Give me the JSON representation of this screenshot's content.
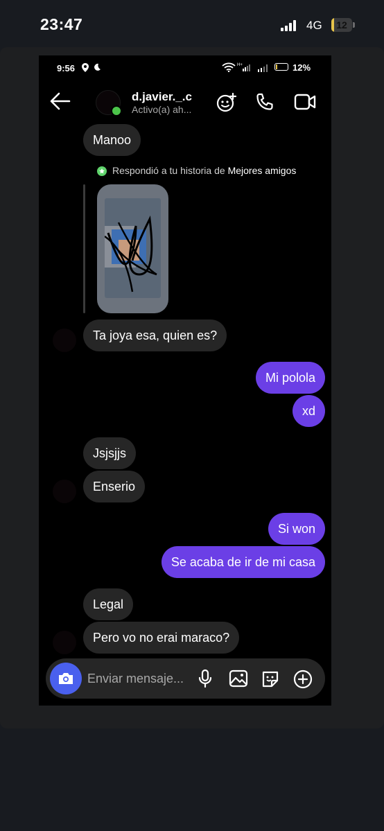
{
  "outer_status": {
    "time": "23:47",
    "network": "4G",
    "battery_level": "12",
    "battery_fraction": 0.12
  },
  "inner_status": {
    "time": "9:56",
    "battery_percent": "12%"
  },
  "header": {
    "username": "d.javier._.c",
    "status": "Activo(a) ah..."
  },
  "story_reply": {
    "label": "Respondió a tu historia de",
    "highlight": "Mejores amigos"
  },
  "messages": [
    {
      "from": "them",
      "text": "Manoo"
    },
    {
      "from": "them",
      "text": "Ta joya esa, quien es?"
    },
    {
      "from": "me",
      "text": "Mi polola"
    },
    {
      "from": "me",
      "text": "xd"
    },
    {
      "from": "them",
      "text": "Jsjsjjs"
    },
    {
      "from": "them",
      "text": "Enserio"
    },
    {
      "from": "me",
      "text": "Si won"
    },
    {
      "from": "me",
      "text": "Se acaba de ir de mi casa"
    },
    {
      "from": "them",
      "text": "Legal"
    },
    {
      "from": "them",
      "text": "Pero vo no erai maraco?"
    }
  ],
  "composer": {
    "placeholder": "Enviar mensaje..."
  },
  "icons": {
    "back": "arrow-left-icon",
    "stickers": "sticker-add-icon",
    "call": "phone-icon",
    "video": "video-camera-icon",
    "camera": "camera-icon",
    "mic": "microphone-icon",
    "gallery": "image-icon",
    "sticker": "sticker-icon",
    "add": "plus-circle-icon"
  },
  "colors": {
    "outgoing_bubble": "#6b3fe6",
    "incoming_bubble": "#262626",
    "camera_button": "#4a60ee",
    "online": "#4cc44a"
  }
}
